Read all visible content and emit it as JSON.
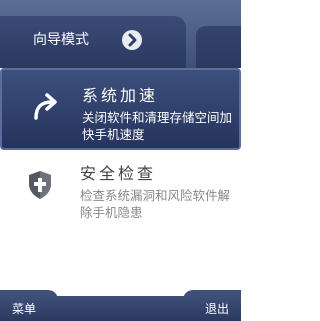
{
  "header": {
    "wizard_mode_label": "向导模式",
    "wizard_arrow_icon": "chevron-right-circle-icon"
  },
  "menu": {
    "items": [
      {
        "title": "系统加速",
        "description": "关闭软件和清理存储空间加快手机速度",
        "icon": "curved-arrow-icon",
        "selected": true
      },
      {
        "title": "安全检查",
        "description": "检查系统漏洞和风险软件解除手机隐患",
        "icon": "shield-cross-icon",
        "selected": false
      }
    ]
  },
  "softkeys": {
    "left": "菜单",
    "right": "退出"
  },
  "colors": {
    "header_bg": "#3e4f79",
    "selected_bg": "#2f3f6a",
    "text_light": "#ffffff",
    "text_dark": "#444444",
    "text_muted": "#888888"
  }
}
